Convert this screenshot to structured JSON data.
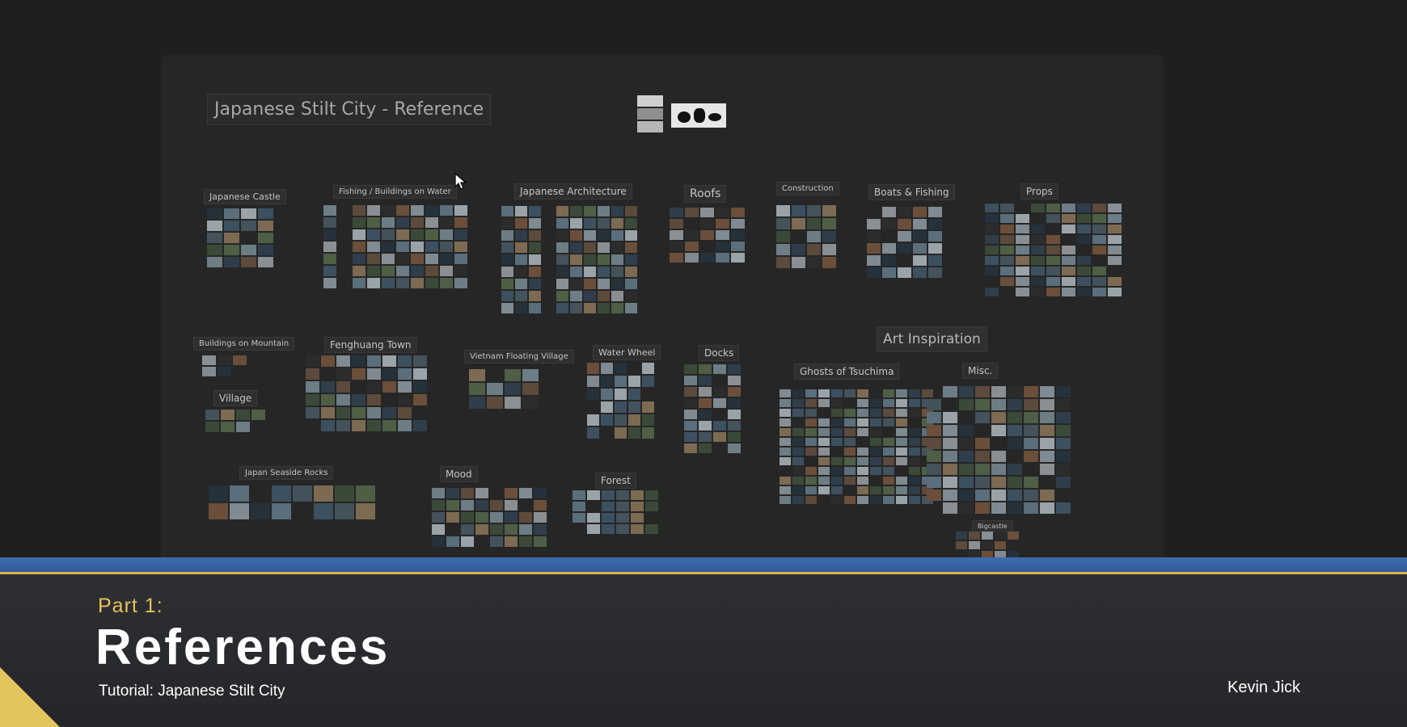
{
  "board": {
    "title": "Japanese Stilt City - Reference",
    "art_inspiration": "Art Inspiration",
    "groups": [
      {
        "label": "Japanese Castle"
      },
      {
        "label": "Fishing / Buildings on Water"
      },
      {
        "label": "Japanese Architecture"
      },
      {
        "label": "Roofs"
      },
      {
        "label": "Construction"
      },
      {
        "label": "Boats & Fishing"
      },
      {
        "label": "Props"
      },
      {
        "label": "Buildings on Mountain"
      },
      {
        "label": "Village"
      },
      {
        "label": "Fenghuang Town"
      },
      {
        "label": "Vietnam Floating Village"
      },
      {
        "label": "Water Wheel"
      },
      {
        "label": "Docks"
      },
      {
        "label": "Ghosts of Tsuchima"
      },
      {
        "label": "Misc."
      },
      {
        "label": "Japan Seaside Rocks"
      },
      {
        "label": "Mood"
      },
      {
        "label": "Forest"
      },
      {
        "label": "Bigcastle"
      }
    ]
  },
  "lower_third": {
    "part": "Part 1:",
    "title": "References",
    "subtitle": "Tutorial: Japanese Stilt City",
    "author": "Kevin Jick"
  },
  "colors": {
    "background": "#1f1f1f",
    "board": "#262626",
    "banner_blue": "#3a66ad",
    "banner_gold": "#d9b24a",
    "part_text": "#e9c15a"
  },
  "icons": [
    "mouse-cursor-icon",
    "corner-triangle"
  ]
}
